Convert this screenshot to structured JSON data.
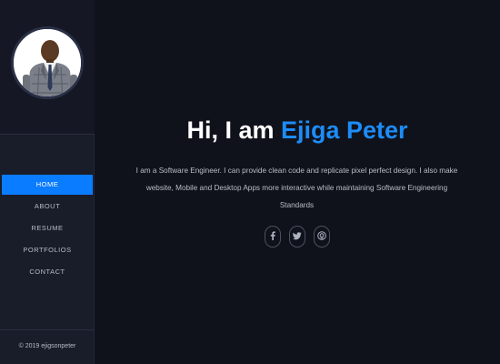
{
  "profile": {
    "photo_alt": "Portrait of Ejiga Peter",
    "name_prefix": "Hi, I am ",
    "name": "Ejiga Peter",
    "bio": "I am a Software Engineer. I can provide clean code and replicate pixel perfect design. I also make website, Mobile and Desktop Apps more interactive while maintaining Software Engineering Standards"
  },
  "nav": {
    "items": [
      {
        "label": "HOME",
        "active": true
      },
      {
        "label": "ABOUT",
        "active": false
      },
      {
        "label": "RESUME",
        "active": false
      },
      {
        "label": "PORTFOLIOS",
        "active": false
      },
      {
        "label": "CONTACT",
        "active": false
      }
    ]
  },
  "footer": {
    "text": "© 2019 ejigsonpeter"
  },
  "socials": [
    {
      "icon": "facebook-icon"
    },
    {
      "icon": "twitter-icon"
    },
    {
      "icon": "github-icon"
    }
  ],
  "colors": {
    "accent": "#1d8cf8",
    "active_nav": "#0a7cff",
    "sidebar_bg": "#191c29",
    "main_bg": "#10121b"
  }
}
